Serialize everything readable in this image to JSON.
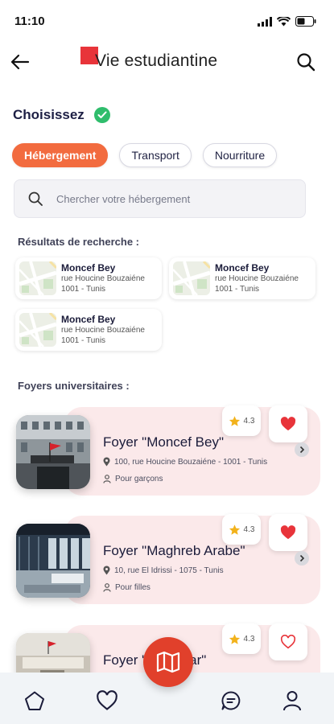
{
  "status": {
    "time": "11:10"
  },
  "header": {
    "title": "Vie estudiantine"
  },
  "choose": {
    "title": "Choisissez"
  },
  "tabs": [
    {
      "label": "Hébergement",
      "active": true
    },
    {
      "label": "Transport",
      "active": false
    },
    {
      "label": "Nourriture",
      "active": false
    }
  ],
  "search": {
    "placeholder": "Chercher votre hébergement"
  },
  "results": {
    "title": "Résultats de recherche :",
    "items": [
      {
        "name": "Moncef Bey",
        "street": "rue Houcine Bouzaiéne",
        "city": "1001 - Tunis"
      },
      {
        "name": "Moncef Bey",
        "street": "rue Houcine Bouzaiéne",
        "city": "1001 - Tunis"
      },
      {
        "name": "Moncef Bey",
        "street": "rue Houcine Bouzaiéne",
        "city": "1001 - Tunis"
      }
    ]
  },
  "foyers": {
    "title": "Foyers universitaires :",
    "items": [
      {
        "name": "Foyer \"Moncef Bey\"",
        "address": "100, rue Houcine Bouzaiéne - 1001 - Tunis",
        "type": "Pour garçons",
        "rating": "4.3",
        "favorite": true
      },
      {
        "name": "Foyer \"Maghreb Arabe\"",
        "address": "10, rue El Idrissi - 1075 - Tunis",
        "type": "Pour filles",
        "rating": "4.3",
        "favorite": true
      },
      {
        "name": "Foyer \"El Manar\"",
        "address": "",
        "type": "",
        "rating": "4.3",
        "favorite": false
      }
    ]
  },
  "colors": {
    "accent": "#f26b3f",
    "fab": "#e1402b",
    "heart": "#e8343a",
    "check": "#2fbd6c",
    "card_bg": "#fbe9ea"
  },
  "nav": {
    "icons": [
      "home-icon",
      "heart-icon",
      "map-icon",
      "chat-icon",
      "user-icon"
    ]
  }
}
